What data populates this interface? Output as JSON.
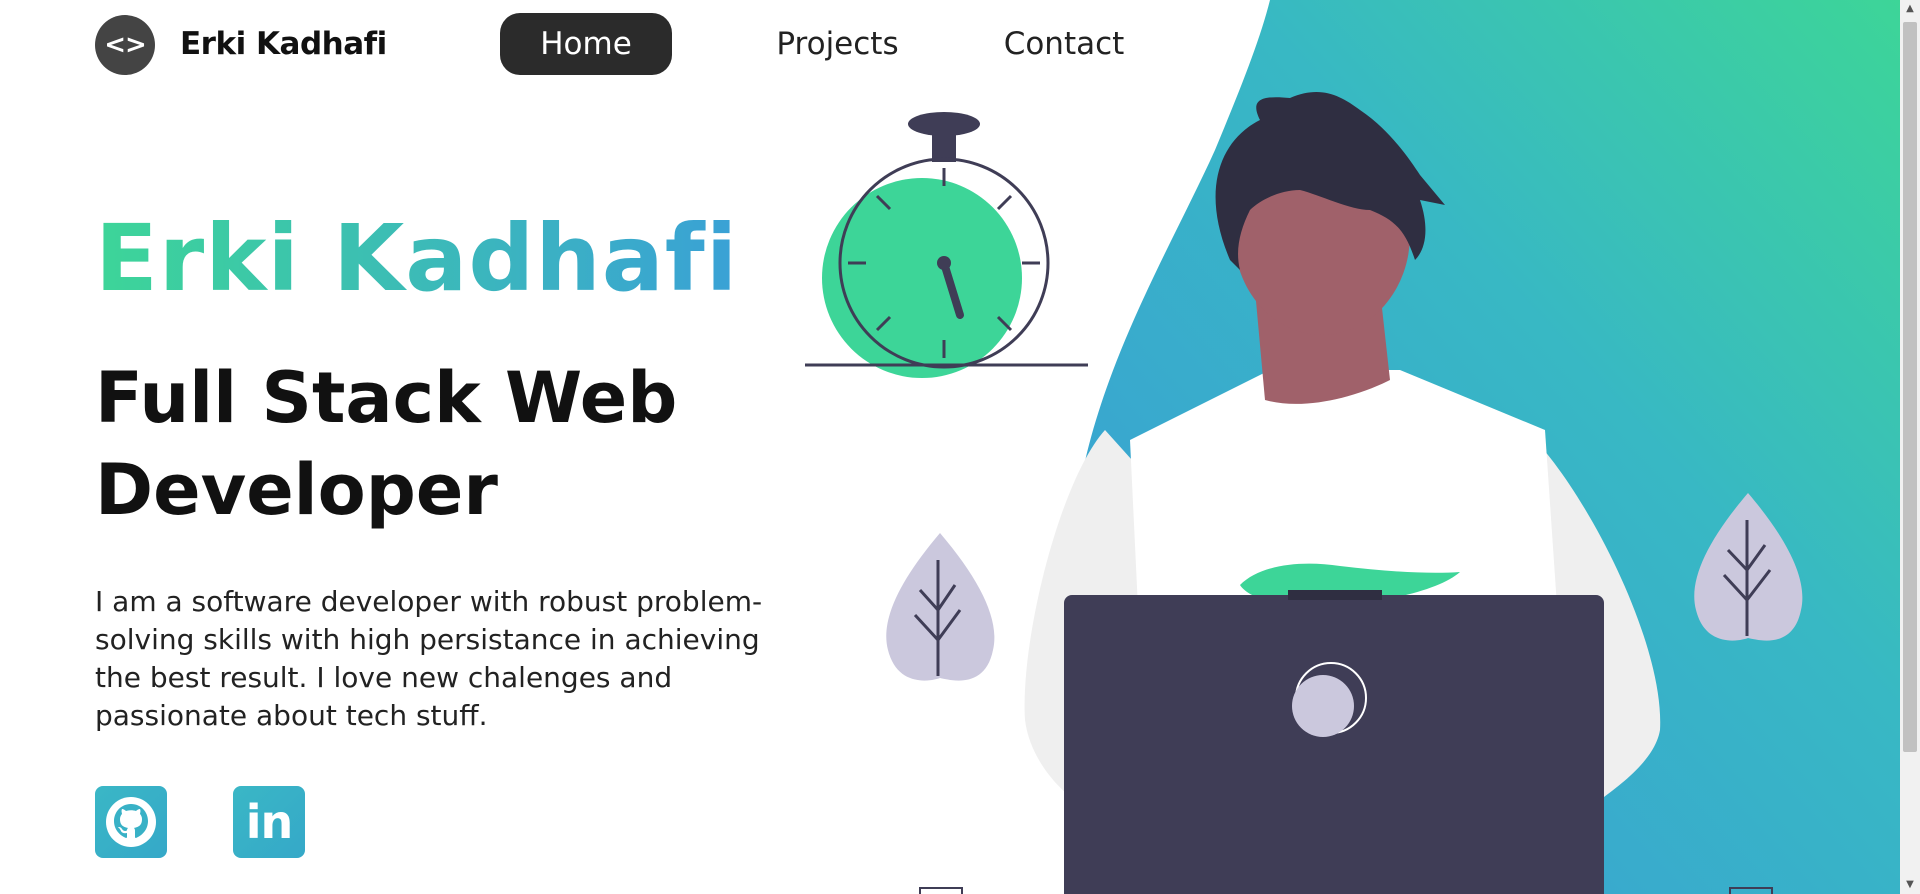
{
  "nav": {
    "logo_glyph": "<>",
    "brand": "Erki Kadhafi",
    "links": [
      {
        "label": "Home",
        "active": true
      },
      {
        "label": "Projects",
        "active": false
      },
      {
        "label": "Contact",
        "active": false
      }
    ]
  },
  "hero": {
    "name": "Erki Kadhafi",
    "role": "Full Stack Web Developer",
    "description": "I am a software developer with robust problem-solving skills with high persistance in achieving the best result. I love new chalenges and passionate about tech stuff."
  },
  "social": {
    "github_icon": "github-icon",
    "linkedin_icon": "linkedin-icon",
    "linkedin_text": "in"
  },
  "colors": {
    "accent_green": "#3dd598",
    "accent_blue": "#3aa1d6",
    "dark": "#2b2b2b",
    "laptop": "#3f3d56",
    "skin": "#a0616a",
    "hair": "#2f2e41",
    "leaf": "#cbc8dd"
  }
}
